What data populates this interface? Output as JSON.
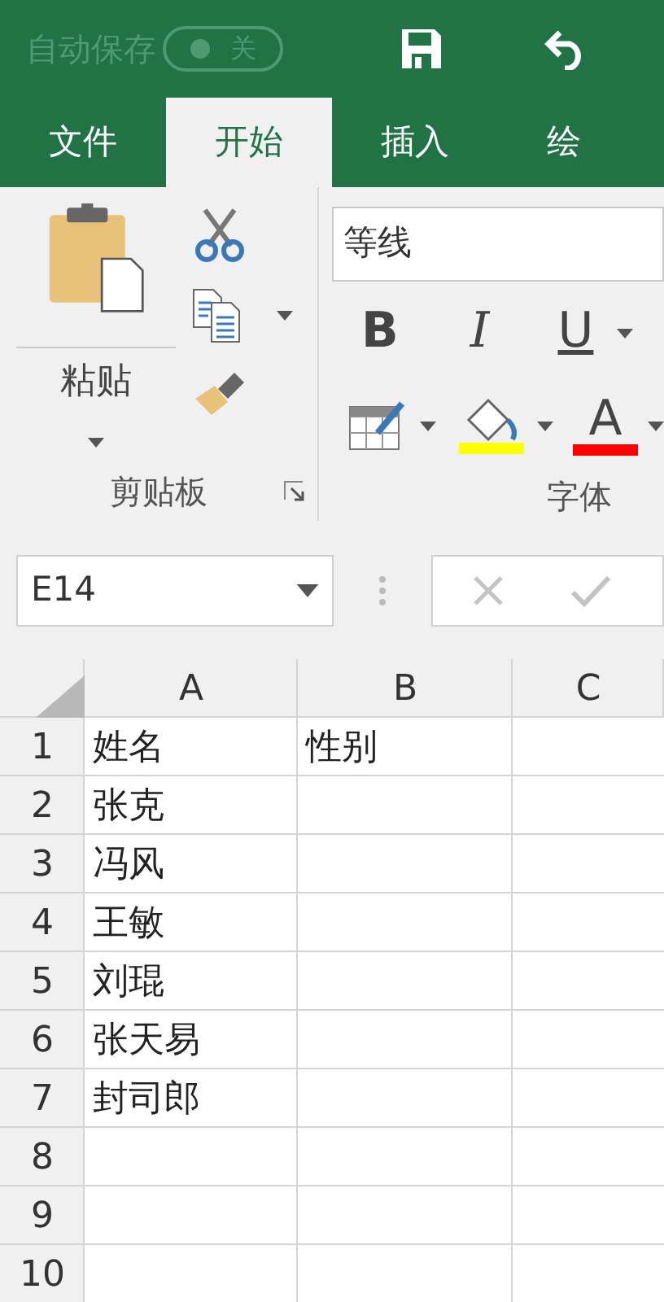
{
  "top_bar": {
    "autosave_label": "自动保存",
    "autosave_toggle": {
      "label": "关",
      "on": false
    }
  },
  "tabs": [
    {
      "label": "文件",
      "selected": false
    },
    {
      "label": "开始",
      "selected": true
    },
    {
      "label": "插入",
      "selected": false
    },
    {
      "label": "绘",
      "selected": false
    }
  ],
  "ribbon": {
    "clipboard": {
      "paste_label": "粘贴",
      "group_label": "剪贴板"
    },
    "font": {
      "font_name": "等线",
      "bold_label": "B",
      "italic_label": "I",
      "underline_label": "U",
      "font_color_label": "A",
      "group_label": "字体"
    }
  },
  "formula_bar": {
    "name_box": "E14"
  },
  "sheet": {
    "columns": [
      "A",
      "B",
      "C"
    ],
    "rows": [
      {
        "number": "1",
        "cells": [
          "姓名",
          "性别"
        ]
      },
      {
        "number": "2",
        "cells": [
          "张克"
        ]
      },
      {
        "number": "3",
        "cells": [
          "冯风"
        ]
      },
      {
        "number": "4",
        "cells": [
          "王敏"
        ]
      },
      {
        "number": "5",
        "cells": [
          "刘琨"
        ]
      },
      {
        "number": "6",
        "cells": [
          "张天易"
        ]
      },
      {
        "number": "7",
        "cells": [
          "封司郎"
        ]
      },
      {
        "number": "8"
      },
      {
        "number": "9"
      },
      {
        "number": "10"
      }
    ]
  }
}
